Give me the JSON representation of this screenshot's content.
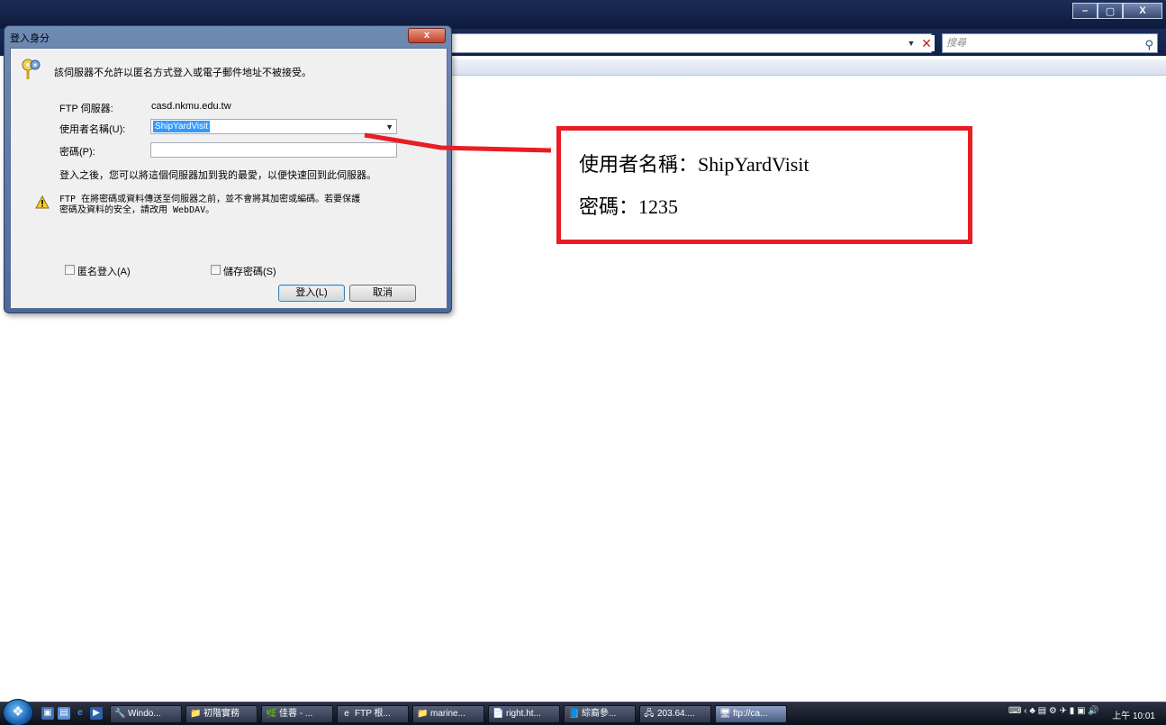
{
  "browser": {
    "search_placeholder": "搜尋",
    "minimize_glyph": "–",
    "maximize_glyph": "▢",
    "close_glyph": "X"
  },
  "dialog": {
    "title": "登入身分",
    "close_glyph": "x",
    "message": "該伺服器不允許以匿名方式登入或電子郵件地址不被接受。",
    "ftp_server_label": "FTP 伺服器:",
    "ftp_server_value": "casd.nkmu.edu.tw",
    "username_label": "使用者名稱(U):",
    "username_value": "ShipYardVisit",
    "password_label": "密碼(P):",
    "password_value": "",
    "favorites_note": "登入之後，您可以將這個伺服器加到我的最愛，以便快速回到此伺服器。",
    "warning_line1": "FTP 在將密碼或資料傳送至伺服器之前，並不會將其加密或編碼。若要保護",
    "warning_line2": "密碼及資料的安全，請改用 WebDAV。",
    "anonymous_label": "匿名登入(A)",
    "save_password_label": "儲存密碼(S)",
    "login_button": "登入(L)",
    "cancel_button": "取消"
  },
  "annotation": {
    "line1": "使用者名稱：ShipYardVisit",
    "line2": "密碼：1235"
  },
  "taskbar": {
    "tasks": [
      {
        "icon": "🔧",
        "label": "Windo..."
      },
      {
        "icon": "📁",
        "label": "初階實務"
      },
      {
        "icon": "🌿",
        "label": "佳蓉 - ..."
      },
      {
        "icon": "e",
        "label": "FTP 根..."
      },
      {
        "icon": "📁",
        "label": "marine..."
      },
      {
        "icon": "📄",
        "label": "right.ht..."
      },
      {
        "icon": "📘",
        "label": "綜裔參..."
      },
      {
        "icon": "🖧",
        "label": "203.64...."
      },
      {
        "icon": "🖥",
        "label": "ftp://ca..."
      }
    ],
    "tray_glyphs": "⌨ ‹ ♣ ▤ ⚙ ✈  ▮ ▣ 🔊",
    "clock": "上午 10:01"
  },
  "colors": {
    "annotation_red": "#ea1c24",
    "selection_blue": "#3399ff"
  }
}
